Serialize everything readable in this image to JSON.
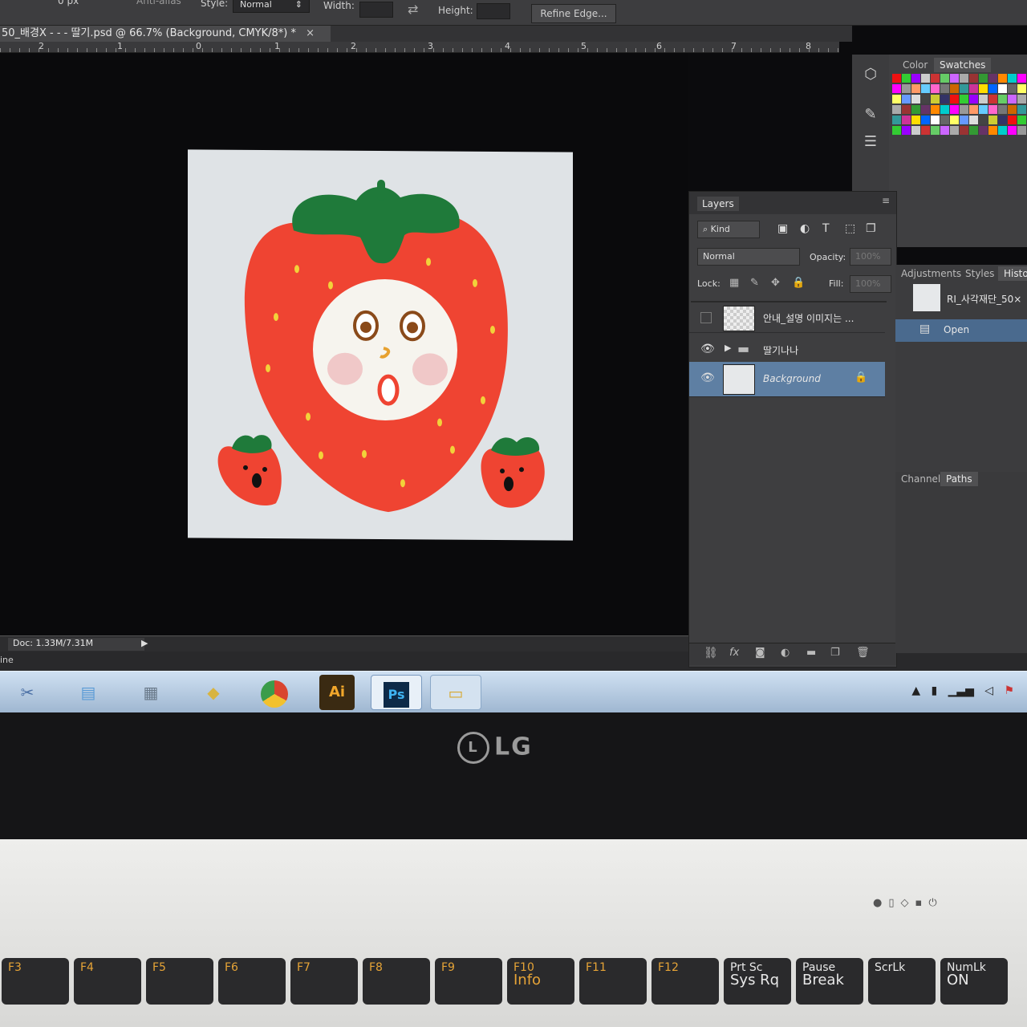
{
  "options_bar": {
    "px_value": "0 px",
    "anti_alias": "Anti-alias",
    "style_label": "Style:",
    "style_value": "Normal",
    "width_label": "Width:",
    "height_label": "Height:",
    "refine_edge": "Refine Edge..."
  },
  "document_tab": {
    "title": "50_배경X - - - 딸기.psd @ 66.7% (Background, CMYK/8*) *",
    "close": "×"
  },
  "ruler": {
    "ticks": [
      "2",
      "1",
      "0",
      "1",
      "2",
      "3",
      "4",
      "5",
      "6",
      "7",
      "8"
    ]
  },
  "status_bar": {
    "doc_info": "Doc: 1.33M/7.31M",
    "timeline": "ine"
  },
  "color_panel": {
    "tabs": [
      "Color",
      "Swatches"
    ]
  },
  "layers_panel": {
    "tab": "Layers",
    "filter": "Kind",
    "blend_mode": "Normal",
    "opacity_label": "Opacity:",
    "opacity_value": "100%",
    "lock_label": "Lock:",
    "fill_label": "Fill:",
    "fill_value": "100%",
    "layers": [
      {
        "name": "안내_설명 이미지는 ...",
        "visible": false
      },
      {
        "name": "딸기나나",
        "visible": true
      },
      {
        "name": "Background",
        "visible": true,
        "selected": true
      }
    ]
  },
  "adjustments_panel": {
    "tabs": [
      "Adjustments",
      "Styles",
      "Histo"
    ],
    "history_snapshot": "RI_사각재단_50×",
    "history_item": "Open"
  },
  "channels_panel": {
    "tabs": [
      "Channels",
      "Paths"
    ]
  },
  "taskbar": {
    "apps": [
      "snipping-tool",
      "notepad",
      "calculator",
      "sticky-notes",
      "chrome",
      "Ai",
      "Ps",
      "file-explorer"
    ]
  },
  "bezel": {
    "brand": "LG"
  },
  "keyboard": {
    "keys": [
      {
        "fn": "F3",
        "label": ""
      },
      {
        "fn": "F4",
        "label": ""
      },
      {
        "fn": "F5",
        "label": ""
      },
      {
        "fn": "F6",
        "label": ""
      },
      {
        "fn": "F7",
        "label": ""
      },
      {
        "fn": "F8",
        "label": ""
      },
      {
        "fn": "F9",
        "label": ""
      },
      {
        "fn": "F10",
        "label": "Info"
      },
      {
        "fn": "F11",
        "label": ""
      },
      {
        "fn": "F12",
        "label": ""
      },
      {
        "fn": "Prt Sc",
        "label": "Sys Rq"
      },
      {
        "fn": "Pause",
        "label": "Break"
      },
      {
        "fn": "ScrLk",
        "label": ""
      },
      {
        "fn": "NumLk",
        "label": "ON"
      }
    ]
  },
  "colors": {
    "strawberry": "#ef4432",
    "leaf": "#1f7a3a",
    "seed": "#f2d23a",
    "selected_layer": "#5e7fa3"
  }
}
